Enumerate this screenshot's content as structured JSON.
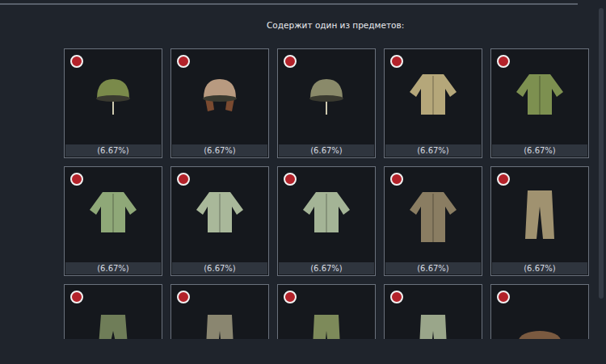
{
  "panel": {
    "title": "Содержит один из предметов:"
  },
  "items": [
    {
      "kind": "helmet",
      "color": "#7a8a4a",
      "marked": true,
      "chance": "(6.67%)"
    },
    {
      "kind": "aviator",
      "color": "#b89a80",
      "marked": true,
      "chance": "(6.67%)"
    },
    {
      "kind": "helmet",
      "color": "#8a8a6a",
      "marked": true,
      "chance": "(6.67%)"
    },
    {
      "kind": "jacket",
      "color": "#b5a77a",
      "marked": true,
      "chance": "(6.67%)"
    },
    {
      "kind": "vest",
      "color": "#7d9050",
      "marked": true,
      "chance": "(6.67%)"
    },
    {
      "kind": "jacket",
      "color": "#8fa878",
      "marked": true,
      "chance": "(6.67%)"
    },
    {
      "kind": "jacket",
      "color": "#a9b89a",
      "marked": true,
      "chance": "(6.67%)"
    },
    {
      "kind": "jacket",
      "color": "#a4b496",
      "marked": true,
      "chance": "(6.67%)"
    },
    {
      "kind": "coat",
      "color": "#8a7d62",
      "marked": true,
      "chance": "(6.67%)"
    },
    {
      "kind": "pants",
      "color": "#a09270",
      "marked": true,
      "chance": "(6.67%)"
    },
    {
      "kind": "shorts",
      "color": "#6f7d58",
      "marked": true
    },
    {
      "kind": "pants",
      "color": "#8a8670",
      "marked": true
    },
    {
      "kind": "pants",
      "color": "#7d8a5a",
      "marked": true
    },
    {
      "kind": "pants",
      "color": "#9aa68a",
      "marked": true
    },
    {
      "kind": "cap",
      "color": "#7a5a40",
      "marked": true
    }
  ]
}
